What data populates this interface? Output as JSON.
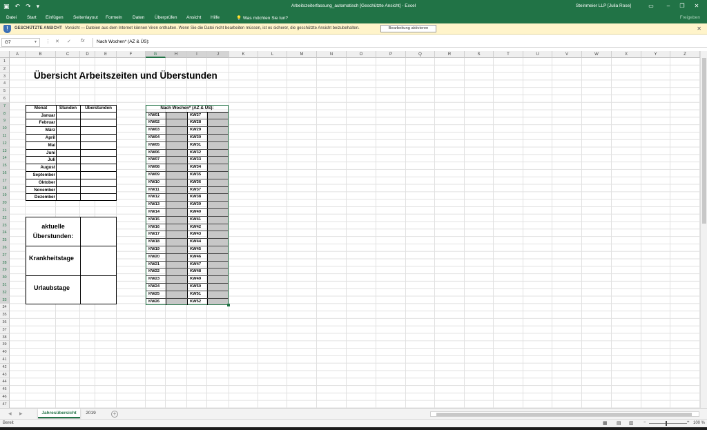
{
  "window": {
    "title": "Arbeitszeiterfassung_automatisch  [Geschützte Ansicht]  -  Excel",
    "user": "Steinmeier LLP [Julia Rose]",
    "share": "Freigeben"
  },
  "menu": [
    "Datei",
    "Start",
    "Einfügen",
    "Seitenlayout",
    "Formeln",
    "Daten",
    "Überprüfen",
    "Ansicht",
    "Hilfe",
    "Was möchten Sie tun?"
  ],
  "protected": {
    "title": "GESCHÜTZTE ANSICHT",
    "message": "Vorsicht — Dateien aus dem Internet können Viren enthalten. Wenn Sie die Datei nicht bearbeiten müssen, ist es sicherer, die geschützte Ansicht beizubehalten.",
    "button": "Bearbeitung aktivieren"
  },
  "formula": {
    "cell": "G7",
    "fx": "fx",
    "content": "Nach Wochen* (AZ & ÜS):"
  },
  "columns": [
    "A",
    "B",
    "C",
    "D",
    "E",
    "F",
    "G",
    "H",
    "I",
    "J",
    "K",
    "L",
    "M",
    "N",
    "O",
    "P",
    "Q",
    "R",
    "S",
    "T",
    "U",
    "V",
    "W",
    "X",
    "Y",
    "Z"
  ],
  "rows": [
    "1",
    "2",
    "3",
    "4",
    "5",
    "6",
    "7",
    "8",
    "9",
    "10",
    "11",
    "12",
    "13",
    "14",
    "15",
    "16",
    "17",
    "18",
    "19",
    "20",
    "21",
    "22",
    "23",
    "24",
    "25",
    "26",
    "27",
    "28",
    "29",
    "30",
    "31",
    "32",
    "33",
    "34",
    "35",
    "36",
    "37",
    "38",
    "39",
    "40",
    "41",
    "42",
    "43",
    "44",
    "45",
    "46",
    "47"
  ],
  "sheet": {
    "title": "Übersicht Arbeitszeiten und Überstunden",
    "month_table": {
      "headers": [
        "Monat",
        "Stunden",
        "Überstunden"
      ],
      "months": [
        "Januar",
        "Februar",
        "März",
        "April",
        "Mai",
        "Juni",
        "Juli",
        "August",
        "September",
        "Oktober",
        "November",
        "Dezember"
      ]
    },
    "summary": {
      "current_l1": "aktuelle",
      "current_l2": "Überstunden:",
      "sick": "Krankheitstage",
      "vacation": "Urlaubstage"
    },
    "weeks": {
      "header": "Nach Wochen* (AZ & ÜS):",
      "left": [
        "KW01",
        "KW02",
        "KW03",
        "KW04",
        "KW05",
        "KW06",
        "KW07",
        "KW08",
        "KW09",
        "KW10",
        "KW11",
        "KW12",
        "KW13",
        "KW14",
        "KW15",
        "KW16",
        "KW17",
        "KW18",
        "KW19",
        "KW20",
        "KW21",
        "KW22",
        "KW23",
        "KW24",
        "KW25",
        "KW26"
      ],
      "right": [
        "KW27",
        "KW28",
        "KW29",
        "KW30",
        "KW31",
        "KW32",
        "KW33",
        "KW34",
        "KW35",
        "KW36",
        "KW37",
        "KW38",
        "KW39",
        "KW40",
        "KW41",
        "KW42",
        "KW43",
        "KW44",
        "KW45",
        "KW46",
        "KW47",
        "KW48",
        "KW49",
        "KW50",
        "KW51",
        "KW52"
      ]
    }
  },
  "tabs": {
    "active": "Jahresübersicht",
    "other": "2019"
  },
  "status": {
    "ready": "Bereit",
    "zoom": "100 %"
  },
  "colors": {
    "excel_green": "#217346",
    "grey_fill": "#c7c7c7"
  }
}
